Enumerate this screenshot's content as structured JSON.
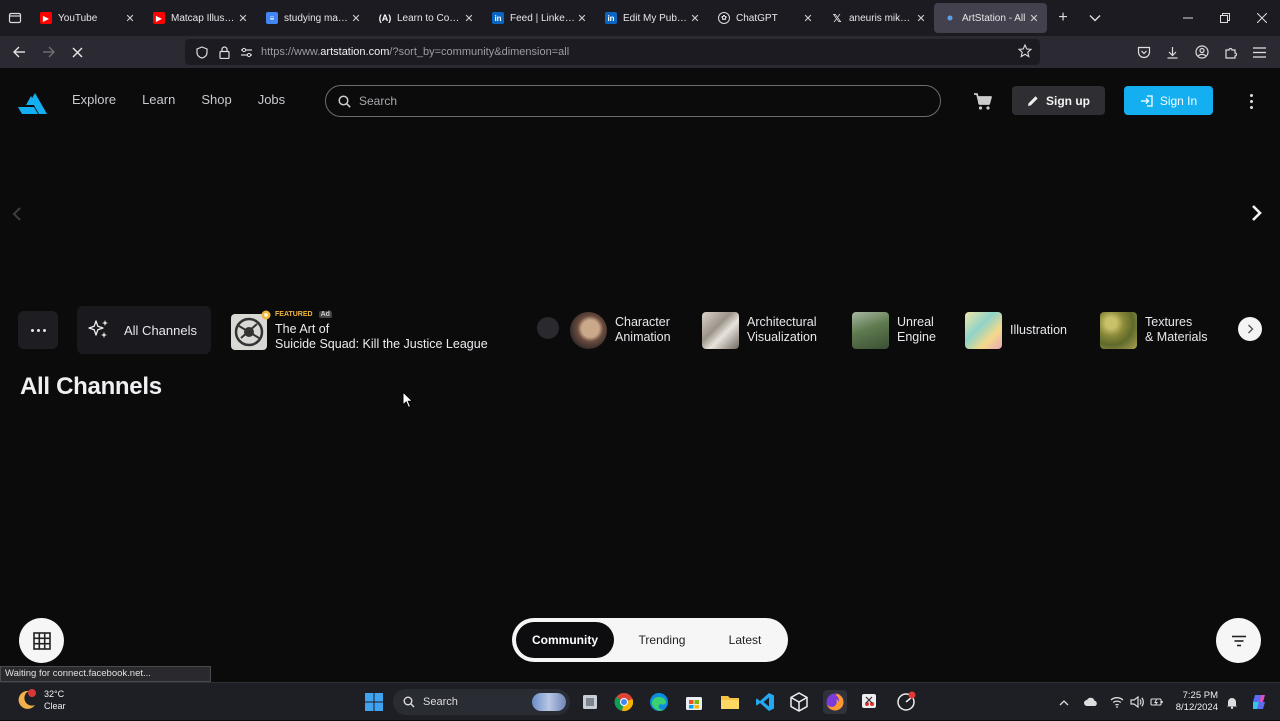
{
  "browser": {
    "tabs": [
      {
        "title": "YouTube",
        "icon": "youtube-icon",
        "color": "#ff0000"
      },
      {
        "title": "Matcap Illustrat",
        "icon": "youtube-icon",
        "color": "#ff0000"
      },
      {
        "title": "studying map - ",
        "icon": "docs-icon",
        "color": "#4285f4"
      },
      {
        "title": "Learn to Code -",
        "icon": "freecodecamp-icon",
        "color": "#ffffff"
      },
      {
        "title": "Feed | LinkedIn",
        "icon": "linkedin-icon",
        "color": "#0a66c2"
      },
      {
        "title": "Edit My Public P",
        "icon": "linkedin-icon",
        "color": "#0a66c2"
      },
      {
        "title": "ChatGPT",
        "icon": "chatgpt-icon",
        "color": "#ffffff"
      },
      {
        "title": "aneuris mike (@",
        "icon": "x-icon",
        "color": "#ffffff"
      },
      {
        "title": "ArtStation - All",
        "icon": "loading-dot-icon",
        "color": "#5aa0e6",
        "active": true
      }
    ],
    "url_prefix": "https://www.",
    "url_domain": "artstation.com",
    "url_rest": "/?sort_by=community&dimension=all",
    "status_text": "Waiting for connect.facebook.net..."
  },
  "site": {
    "nav": [
      "Explore",
      "Learn",
      "Shop",
      "Jobs"
    ],
    "search_placeholder": "Search",
    "signup_label": "Sign up",
    "signin_label": "Sign In",
    "accent_color": "#13aff0"
  },
  "channels": {
    "all_label": "All Channels",
    "featured_tag": "FEATURED",
    "ad_tag": "Ad",
    "featured_line1": "The Art of",
    "featured_line2": "Suicide Squad: Kill the Justice League",
    "items": [
      {
        "line1": "Character",
        "line2": "Animation"
      },
      {
        "line1": "Architectural",
        "line2": "Visualization"
      },
      {
        "line1": "Unreal",
        "line2": "Engine"
      },
      {
        "line1": "Illustration",
        "line2": ""
      },
      {
        "line1": "Textures",
        "line2": "& Materials"
      }
    ]
  },
  "page_title": "All Channels",
  "sort": {
    "options": [
      "Community",
      "Trending",
      "Latest"
    ],
    "active": "Community"
  },
  "taskbar": {
    "temp": "32°C",
    "weather": "Clear",
    "search_label": "Search",
    "time": "7:25 PM",
    "date": "8/12/2024"
  }
}
